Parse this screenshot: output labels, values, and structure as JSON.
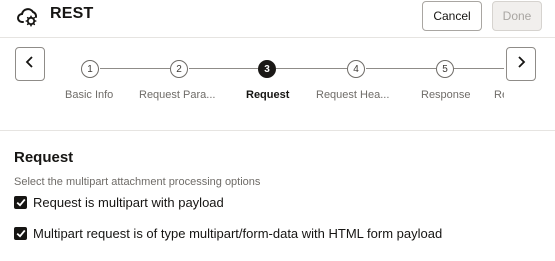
{
  "header": {
    "title": "REST",
    "icon": "rest-adapter-icon",
    "cancel_label": "Cancel",
    "done_label": "Done"
  },
  "train": {
    "steps": [
      {
        "number": "1",
        "label": "Basic Info",
        "state": "visited"
      },
      {
        "number": "2",
        "label": "Request Para...",
        "state": "visited"
      },
      {
        "number": "3",
        "label": "Request",
        "state": "current"
      },
      {
        "number": "4",
        "label": "Request Hea...",
        "state": "upcoming"
      },
      {
        "number": "5",
        "label": "Response",
        "state": "upcoming"
      },
      {
        "number": "",
        "label": "Re",
        "state": "upcoming"
      }
    ],
    "prev_icon": "chevron-left-icon",
    "next_icon": "chevron-right-icon"
  },
  "section": {
    "title": "Request",
    "description": "Select the multipart attachment processing options",
    "options": [
      {
        "label": "Request is multipart with payload",
        "checked": true
      },
      {
        "label": "Multipart request is of type multipart/form-data with HTML form payload",
        "checked": true
      }
    ]
  },
  "colors": {
    "active_step": "#1a1816",
    "muted_text": "#6f6c68",
    "border": "#e6e4e1"
  }
}
